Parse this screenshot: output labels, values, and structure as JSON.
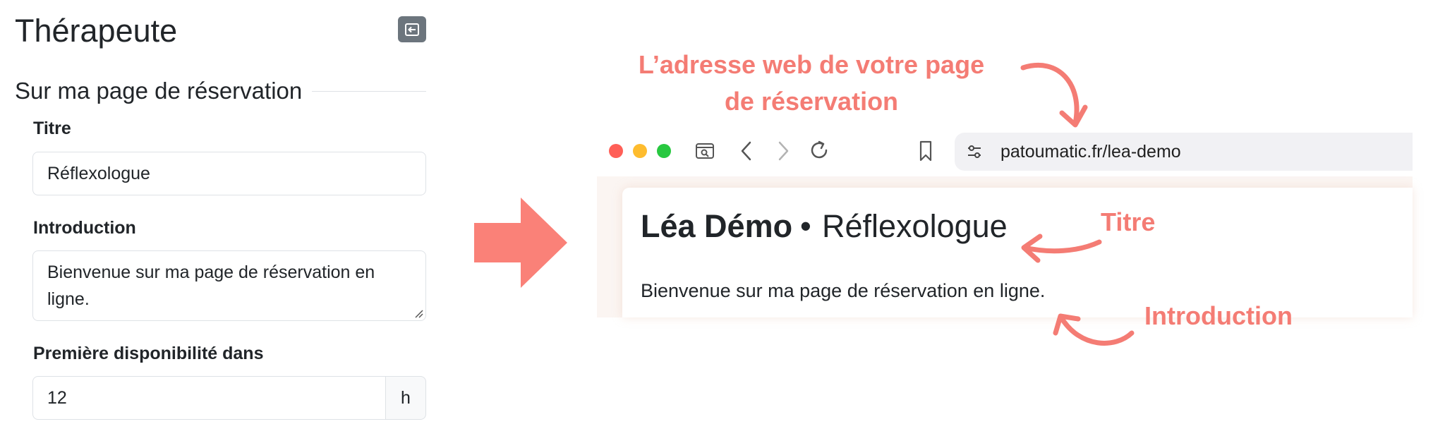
{
  "panel": {
    "title": "Thérapeute",
    "section_title": "Sur ma page de réservation",
    "fields": {
      "titre": {
        "label": "Titre",
        "value": "Réflexologue"
      },
      "introduction": {
        "label": "Introduction",
        "value": "Bienvenue sur ma page de réservation en ligne."
      },
      "disponibilite": {
        "label": "Première disponibilité dans",
        "value": "12",
        "unit": "h"
      }
    },
    "exit_icon": "exit-icon"
  },
  "browser": {
    "url_host": "patoumatic.fr/",
    "url_path": "lea-demo",
    "page": {
      "name": "Léa Démo",
      "separator": "•",
      "title": "Réflexologue",
      "intro": "Bienvenue sur ma page de réservation en ligne."
    }
  },
  "annotations": {
    "address_line1": "L’adresse web de votre page",
    "address_line2": "de réservation",
    "titre": "Titre",
    "introduction": "Introduction"
  },
  "colors": {
    "accent": "#f47c74",
    "arrow": "#fa8178",
    "traffic_red": "#ff5f57",
    "traffic_yellow": "#febc2e",
    "traffic_green": "#28c840",
    "exit_button": "#6c757d"
  }
}
